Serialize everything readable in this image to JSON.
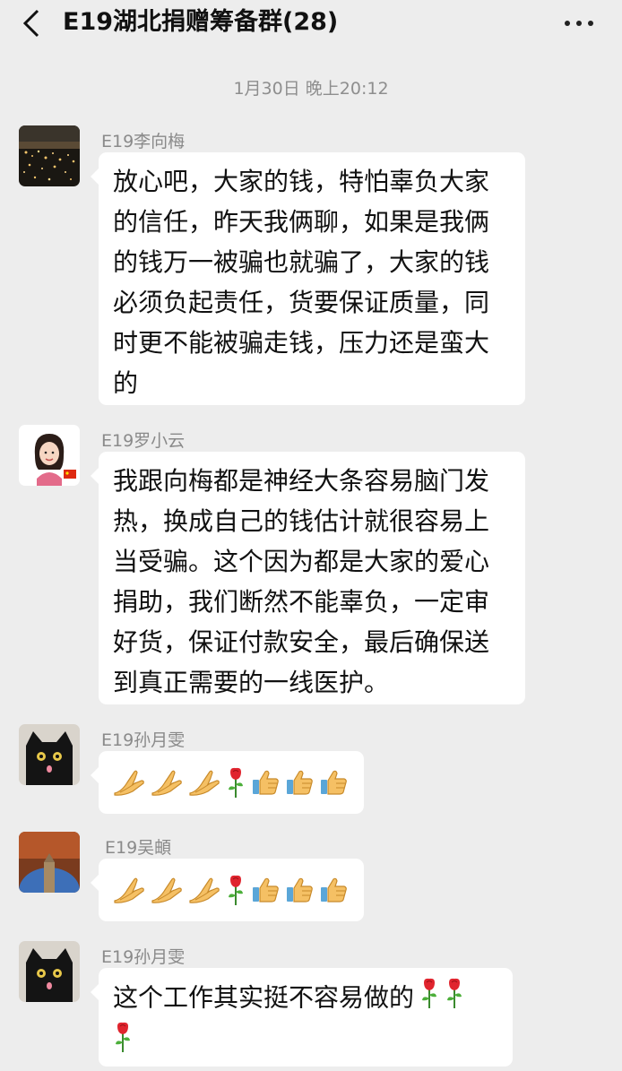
{
  "header": {
    "title": "E19湖北捐赠筹备群(28)"
  },
  "timestamp": "1月30日 晚上20:12",
  "messages": [
    {
      "sender": "E19李向梅",
      "lines": [
        "放心吧，大家的钱，特怕辜负大家",
        "的信任，昨天我俩聊，如果是我俩",
        "的钱万一被骗也就骗了，大家的钱",
        "必须负起责任，货要保证质量，同",
        "时更不能被骗走钱，压力还是蛮大",
        "的"
      ]
    },
    {
      "sender": "E19罗小云",
      "lines": [
        "我跟向梅都是神经大条容易脑门发",
        "热，换成自己的钱估计就很容易上",
        "当受骗。这个因为都是大家的爱心",
        "捐助，我们断然不能辜负，一定审",
        "好货，保证付款安全，最后确保送",
        "到真正需要的一线医护。"
      ]
    },
    {
      "sender": "E19孙月雯",
      "emojis": [
        "pray-emoji",
        "pray-emoji",
        "pray-emoji",
        "rose-emoji",
        "thumbs-up-emoji",
        "thumbs-up-emoji",
        "thumbs-up-emoji"
      ]
    },
    {
      "sender": "E19吴頔",
      "emojis": [
        "pray-emoji",
        "pray-emoji",
        "pray-emoji",
        "rose-emoji",
        "thumbs-up-emoji",
        "thumbs-up-emoji",
        "thumbs-up-emoji"
      ]
    },
    {
      "sender": "E19孙月雯",
      "lines": [
        "这个工作其实挺不容易做的"
      ],
      "trailing_emojis": [
        "rose-emoji",
        "rose-emoji",
        "rose-emoji"
      ]
    }
  ],
  "icons": {
    "back": "chevron-left-icon",
    "more": "more-dots-icon"
  }
}
